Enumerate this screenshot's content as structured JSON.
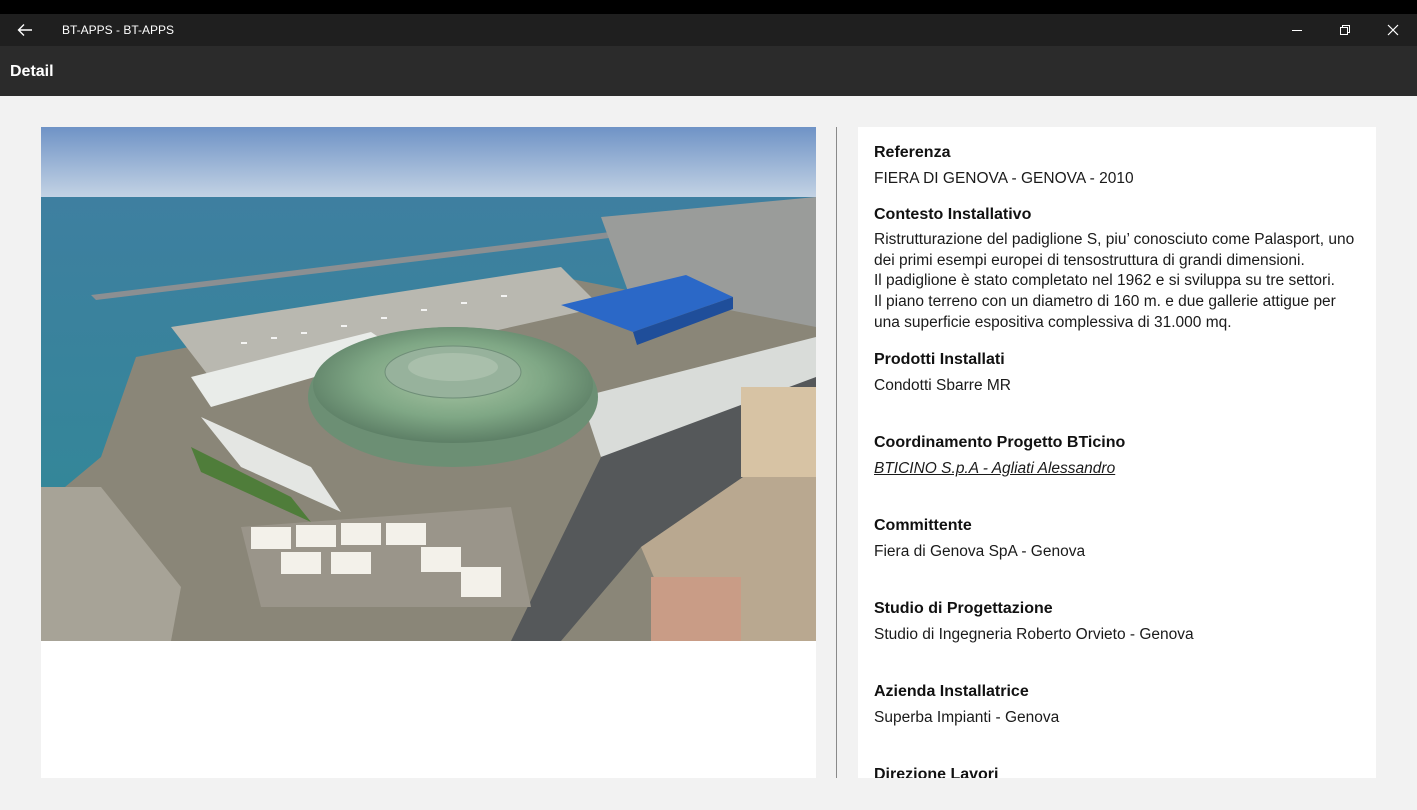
{
  "window": {
    "title": "BT-APPS - BT-APPS"
  },
  "header": {
    "title": "Detail"
  },
  "photo": {
    "alt": "Aerial view of Fiera di Genova exhibition center"
  },
  "details": {
    "referenza": {
      "label": "Referenza",
      "value": "FIERA DI GENOVA - GENOVA - 2010"
    },
    "contesto": {
      "label": "Contesto Installativo",
      "lines": [
        "Ristrutturazione del padiglione S, piu’ conosciuto come Palasport, uno",
        "dei primi esempi europei di tensostruttura di grandi dimensioni.",
        "Il padiglione è stato completato nel 1962 e si sviluppa su tre settori.",
        "Il piano terreno con un diametro di 160 m. e due gallerie attigue per",
        "una superficie espositiva complessiva di 31.000 mq."
      ]
    },
    "prodotti": {
      "label": "Prodotti Installati",
      "value": "Condotti Sbarre MR"
    },
    "coordinamento": {
      "label": "Coordinamento Progetto BTicino",
      "value": "BTICINO S.p.A - Agliati Alessandro"
    },
    "committente": {
      "label": "Committente",
      "value": "Fiera di Genova SpA - Genova"
    },
    "studio": {
      "label": "Studio di Progettazione",
      "value": "Studio di Ingegneria Roberto Orvieto - Genova"
    },
    "azienda": {
      "label": "Azienda Installatrice",
      "value": "Superba Impianti - Genova"
    },
    "direzione": {
      "label": "Direzione Lavori"
    }
  }
}
